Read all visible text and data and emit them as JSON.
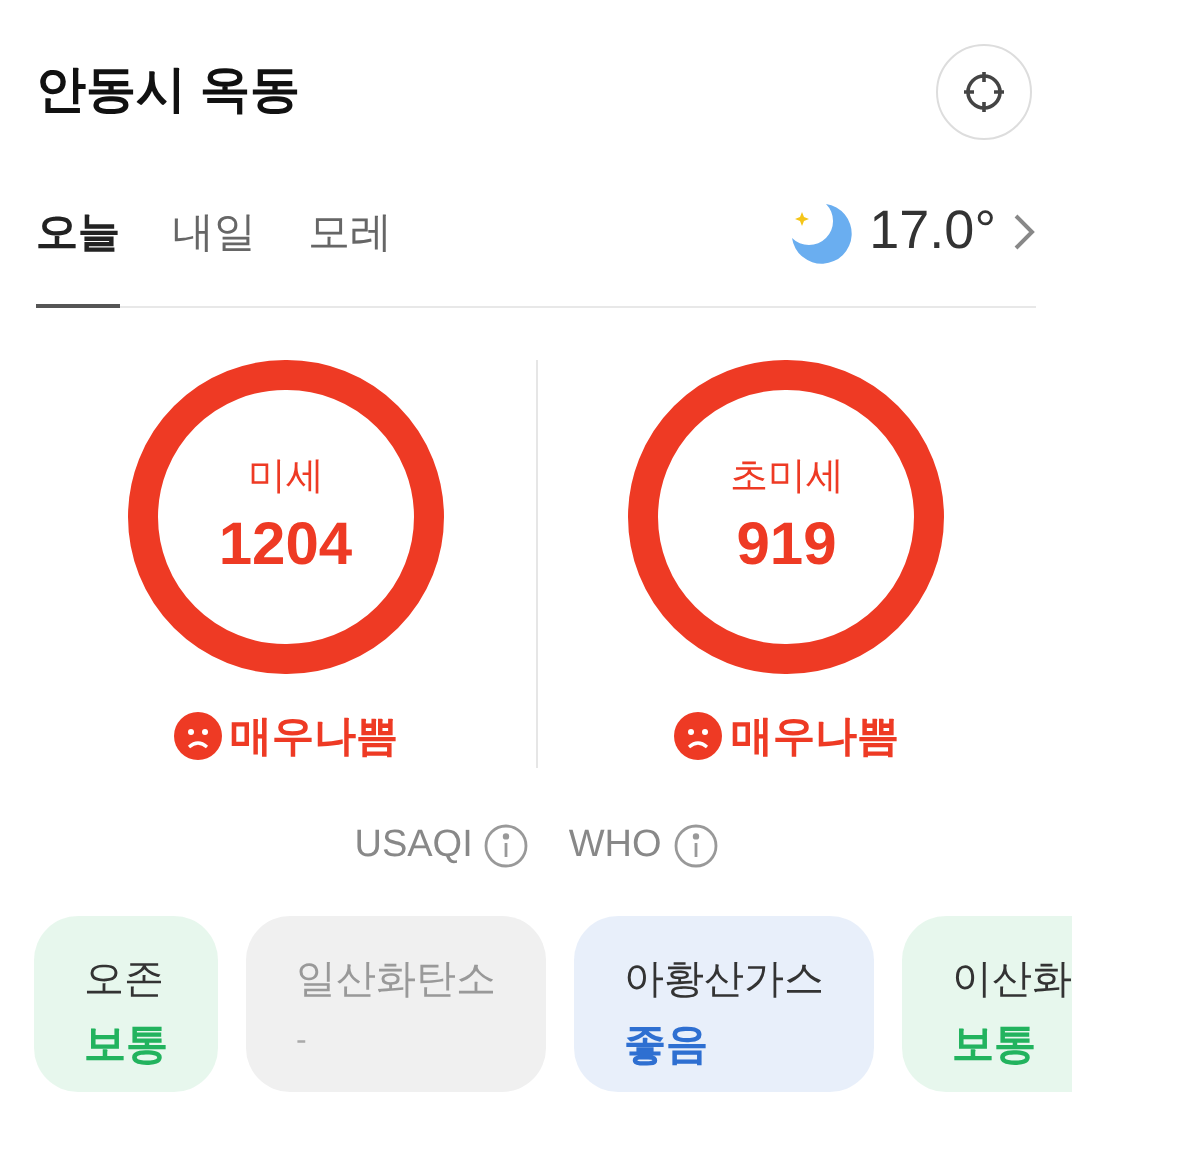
{
  "location": {
    "title": "안동시 옥동"
  },
  "tabs": [
    {
      "label": "오늘",
      "selected": true
    },
    {
      "label": "내일",
      "selected": false
    },
    {
      "label": "모레",
      "selected": false
    }
  ],
  "weather": {
    "temperature": "17.0°"
  },
  "dust": [
    {
      "label": "미세",
      "value": "1204",
      "status": "매우나쁨",
      "color": "#ee3a24"
    },
    {
      "label": "초미세",
      "value": "919",
      "status": "매우나쁨",
      "color": "#ee3a24"
    }
  ],
  "standards": [
    "USAQI",
    "WHO"
  ],
  "pollutants": [
    {
      "name": "오존",
      "status": "보통",
      "color": "#22b35e",
      "disabled": false
    },
    {
      "name": "일산화탄소",
      "status": "-",
      "color": "#aaaaaa",
      "disabled": true
    },
    {
      "name": "아황산가스",
      "status": "좋음",
      "color": "#2e6fd1",
      "disabled": false
    },
    {
      "name": "이산화",
      "status": "보통",
      "color": "#22b35e",
      "disabled": false
    }
  ]
}
